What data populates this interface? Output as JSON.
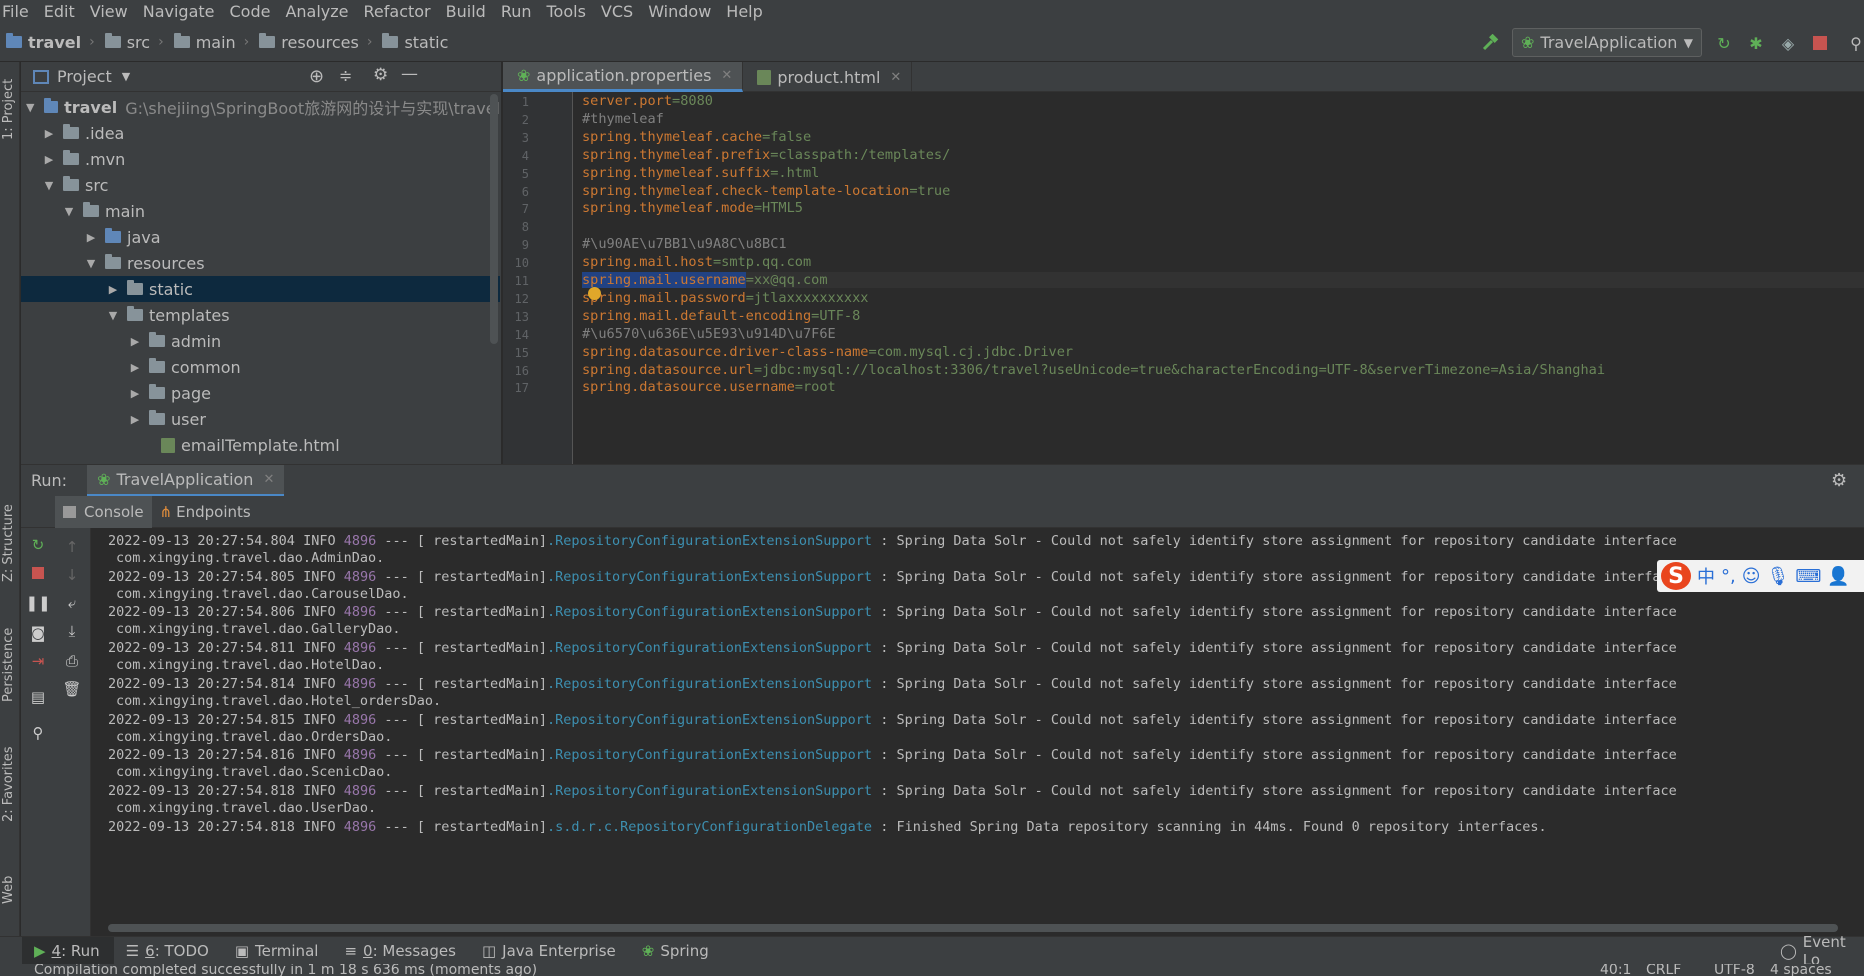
{
  "menu": [
    "File",
    "Edit",
    "View",
    "Navigate",
    "Code",
    "Analyze",
    "Refactor",
    "Build",
    "Run",
    "Tools",
    "VCS",
    "Window",
    "Help"
  ],
  "breadcrumb": [
    "travel",
    "src",
    "main",
    "resources",
    "static"
  ],
  "run_config": "TravelApplication",
  "project": {
    "title": "Project",
    "root_name": "travel",
    "root_path": "G:\\shejiing\\SpringBoot旅游网的设计与实现\\travel",
    "items": [
      ".idea",
      ".mvn",
      "src",
      "main",
      "java",
      "resources",
      "static",
      "templates",
      "admin",
      "common",
      "page",
      "user",
      "emailTemplate.html"
    ]
  },
  "editor": {
    "tabs": [
      "application.properties",
      "product.html"
    ],
    "line_numbers": [
      "1",
      "2",
      "3",
      "4",
      "5",
      "6",
      "7",
      "8",
      "9",
      "10",
      "11",
      "12",
      "13",
      "14",
      "15",
      "16",
      "17"
    ],
    "lines": [
      {
        "k": "server.port",
        "v": "=8080"
      },
      {
        "c": "#thymeleaf"
      },
      {
        "k": "spring.thymeleaf.cache",
        "v": "=false"
      },
      {
        "k": "spring.thymeleaf.prefix",
        "v": "=classpath:/templates/"
      },
      {
        "k": "spring.thymeleaf.suffix",
        "v": "=.html"
      },
      {
        "k": "spring.thymeleaf.check-template-location",
        "v": "=true"
      },
      {
        "k": "spring.thymeleaf.mode",
        "v": "=HTML5"
      },
      {
        "c": ""
      },
      {
        "c": "#\\u90AE\\u7BB1\\u9A8C\\u8BC1"
      },
      {
        "k": "spring.mail.host",
        "v": "=smtp.qq.com"
      },
      {
        "k": "spring.mail.username",
        "v": "=xx@qq.com"
      },
      {
        "k": "spring.mail.password",
        "v": "=jtlaxxxxxxxxxx"
      },
      {
        "k": "spring.mail.default-encoding",
        "v": "=UTF-8"
      },
      {
        "c": "#\\u6570\\u636E\\u5E93\\u914D\\u7F6E"
      },
      {
        "k": "spring.datasource.driver-class-name",
        "v": "=com.mysql.cj.jdbc.Driver"
      },
      {
        "k": "spring.datasource.url",
        "v": "=jdbc:mysql://localhost:3306/travel?useUnicode=true&characterEncoding=UTF-8&serverTimezone=Asia/Shanghai"
      },
      {
        "k": "spring.datasource.username",
        "v": "=root"
      }
    ]
  },
  "run_panel": {
    "label": "Run:",
    "tab": "TravelApplication",
    "subtabs": [
      "Console",
      "Endpoints"
    ]
  },
  "console": [
    {
      "t": "2022-09-13 20:27:54.804",
      "lvl": "INFO",
      "pid": "4896",
      "sep": "--- [",
      "thr": " restartedMain]",
      "cls": ".RepositoryConfigurationExtensionSupport",
      "msg": " : Spring Data Solr - Could not safely identify store assignment for repository candidate interface",
      "cont": "com.xingying.travel.dao.AdminDao."
    },
    {
      "t": "2022-09-13 20:27:54.805",
      "lvl": "INFO",
      "pid": "4896",
      "sep": "--- [",
      "thr": " restartedMain]",
      "cls": ".RepositoryConfigurationExtensionSupport",
      "msg": " : Spring Data Solr - Could not safely identify store assignment for repository candidate interface",
      "cont": "com.xingying.travel.dao.CarouselDao."
    },
    {
      "t": "2022-09-13 20:27:54.806",
      "lvl": "INFO",
      "pid": "4896",
      "sep": "--- [",
      "thr": " restartedMain]",
      "cls": ".RepositoryConfigurationExtensionSupport",
      "msg": " : Spring Data Solr - Could not safely identify store assignment for repository candidate interface",
      "cont": "com.xingying.travel.dao.GalleryDao."
    },
    {
      "t": "2022-09-13 20:27:54.811",
      "lvl": "INFO",
      "pid": "4896",
      "sep": "--- [",
      "thr": " restartedMain]",
      "cls": ".RepositoryConfigurationExtensionSupport",
      "msg": " : Spring Data Solr - Could not safely identify store assignment for repository candidate interface",
      "cont": "com.xingying.travel.dao.HotelDao."
    },
    {
      "t": "2022-09-13 20:27:54.814",
      "lvl": "INFO",
      "pid": "4896",
      "sep": "--- [",
      "thr": " restartedMain]",
      "cls": ".RepositoryConfigurationExtensionSupport",
      "msg": " : Spring Data Solr - Could not safely identify store assignment for repository candidate interface",
      "cont": "com.xingying.travel.dao.Hotel_ordersDao."
    },
    {
      "t": "2022-09-13 20:27:54.815",
      "lvl": "INFO",
      "pid": "4896",
      "sep": "--- [",
      "thr": " restartedMain]",
      "cls": ".RepositoryConfigurationExtensionSupport",
      "msg": " : Spring Data Solr - Could not safely identify store assignment for repository candidate interface",
      "cont": "com.xingying.travel.dao.OrdersDao."
    },
    {
      "t": "2022-09-13 20:27:54.816",
      "lvl": "INFO",
      "pid": "4896",
      "sep": "--- [",
      "thr": " restartedMain]",
      "cls": ".RepositoryConfigurationExtensionSupport",
      "msg": " : Spring Data Solr - Could not safely identify store assignment for repository candidate interface",
      "cont": "com.xingying.travel.dao.ScenicDao."
    },
    {
      "t": "2022-09-13 20:27:54.818",
      "lvl": "INFO",
      "pid": "4896",
      "sep": "--- [",
      "thr": " restartedMain]",
      "cls": ".RepositoryConfigurationExtensionSupport",
      "msg": " : Spring Data Solr - Could not safely identify store assignment for repository candidate interface",
      "cont": "com.xingying.travel.dao.UserDao."
    },
    {
      "t": "2022-09-13 20:27:54.818",
      "lvl": "INFO",
      "pid": "4896",
      "sep": "--- [",
      "thr": " restartedMain]",
      "cls": ".s.d.r.c.RepositoryConfigurationDelegate",
      "msg": " : Finished Spring Data repository scanning in 44ms. Found 0 repository interfaces.",
      "cont": ""
    }
  ],
  "left_stripe": [
    "1: Project",
    "Z: Structure",
    "Persistence",
    "2: Favorites",
    "Web"
  ],
  "bottom_tabs": [
    {
      "num": "4",
      "label": ": Run"
    },
    {
      "num": "6",
      "label": ": TODO"
    },
    {
      "num": "",
      "label": "Terminal"
    },
    {
      "num": "0",
      "label": ": Messages"
    },
    {
      "num": "",
      "label": "Java Enterprise"
    },
    {
      "num": "",
      "label": "Spring"
    }
  ],
  "event_log": "Event Lo",
  "status": {
    "message": "Compilation completed successfully in 1 m 18 s 636 ms (moments ago)",
    "position": "40:1",
    "line_sep": "CRLF",
    "encoding": "UTF-8",
    "indent": "4 spaces"
  },
  "ime": {
    "lang": "中",
    "punct": "°,"
  },
  "colors": {
    "keyword": "#cc7832",
    "value": "#6a8759",
    "comment": "#808080",
    "console_class": "#3d8fb0",
    "selection": "#0d293e"
  }
}
